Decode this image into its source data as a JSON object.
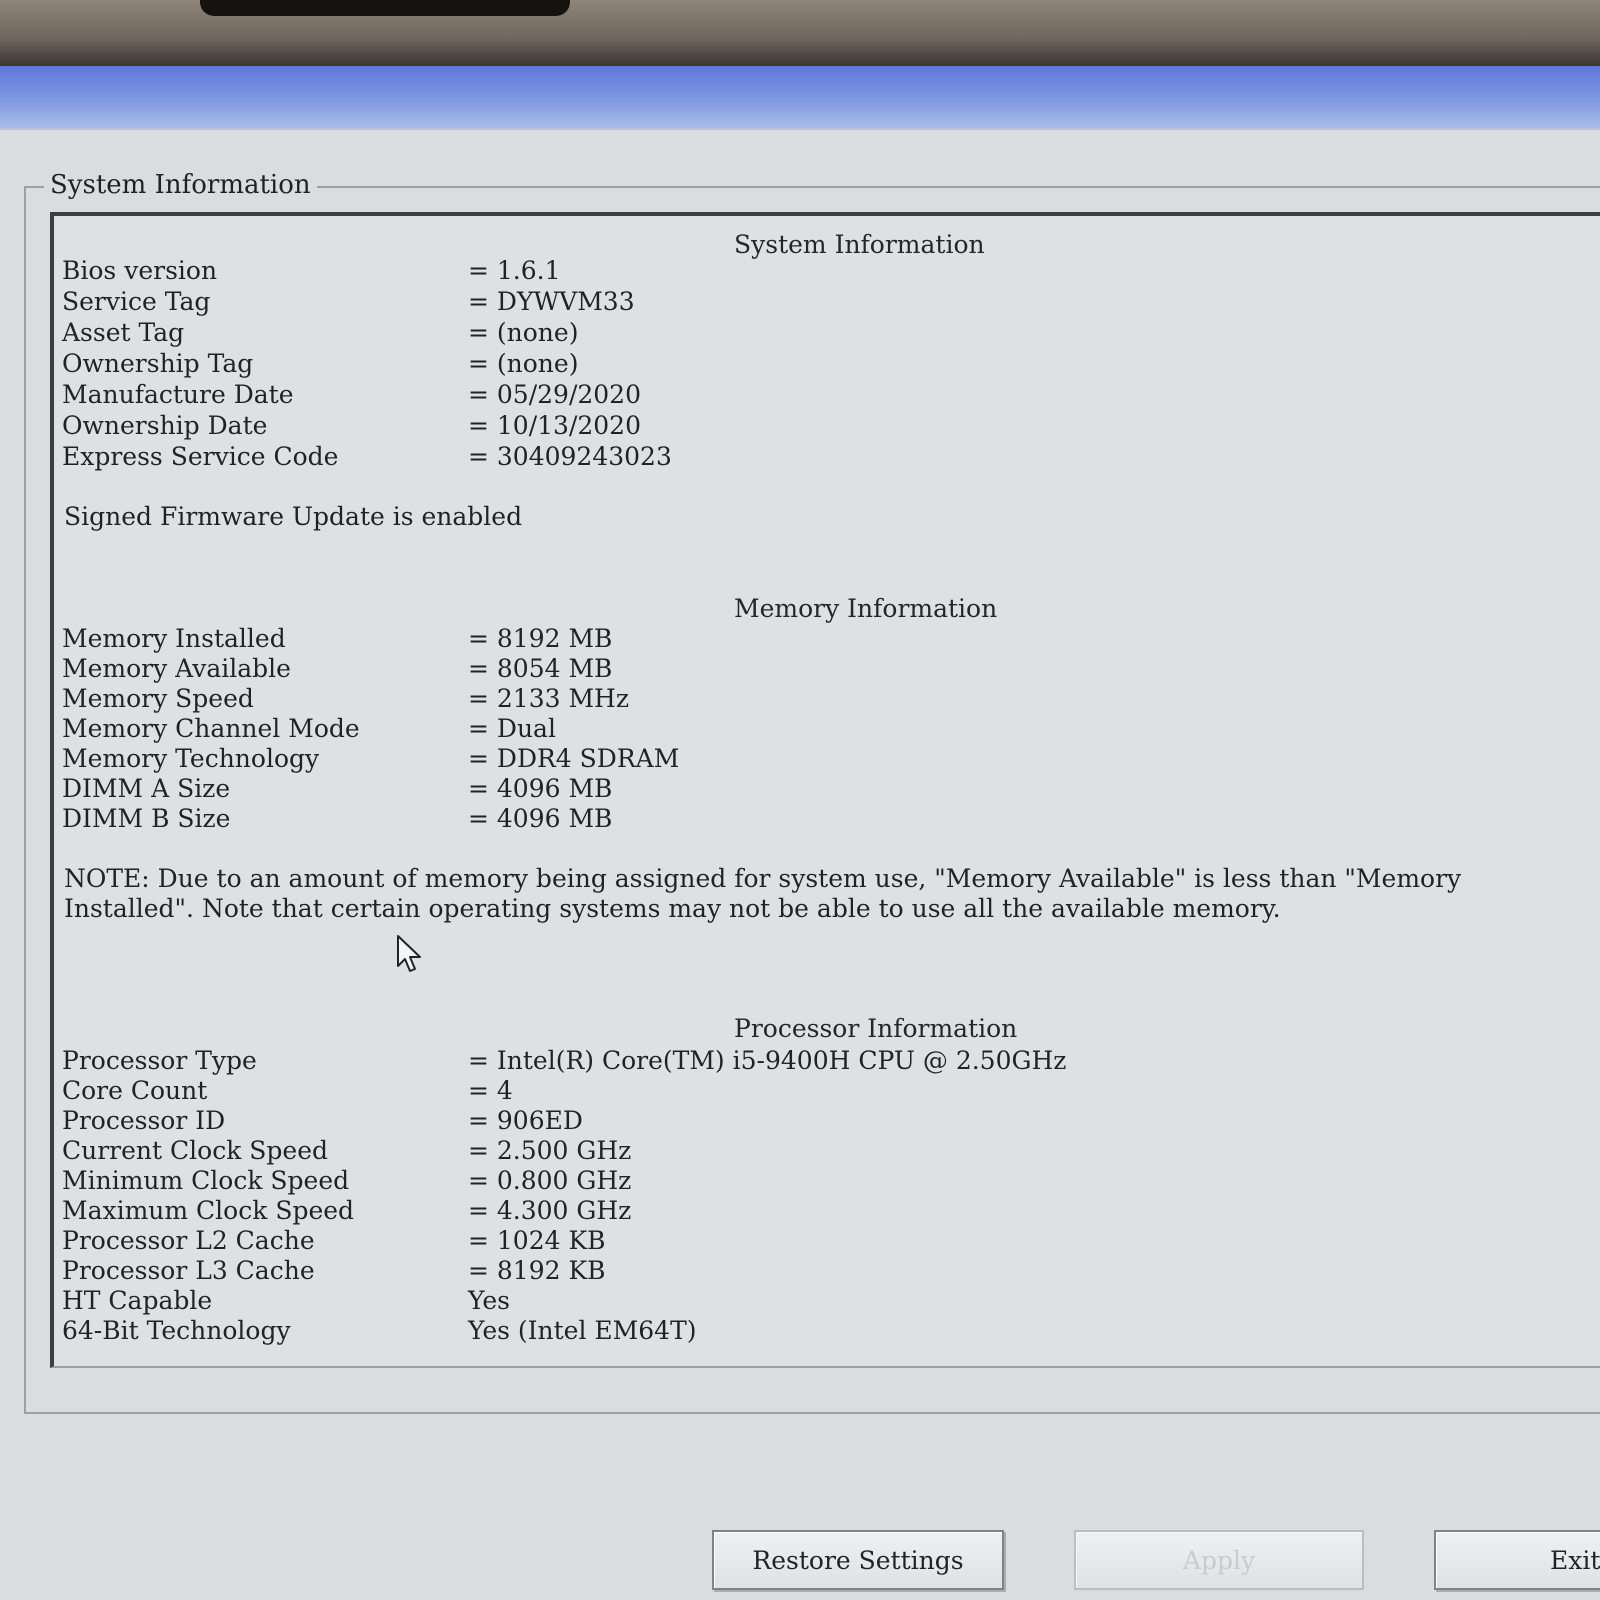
{
  "groupbox": {
    "title": "System Information"
  },
  "system": {
    "title": "System Information",
    "rows": [
      {
        "label": "Bios version",
        "value": "= 1.6.1"
      },
      {
        "label": "Service Tag",
        "value": "= DYWVM33"
      },
      {
        "label": "Asset Tag",
        "value": "= (none)"
      },
      {
        "label": "Ownership Tag",
        "value": "= (none)"
      },
      {
        "label": "Manufacture Date",
        "value": "= 05/29/2020"
      },
      {
        "label": "Ownership Date",
        "value": "= 10/13/2020"
      },
      {
        "label": "Express Service Code",
        "value": "= 30409243023"
      }
    ],
    "firmware_status": "Signed Firmware Update is enabled"
  },
  "memory": {
    "title": "Memory Information",
    "rows": [
      {
        "label": "Memory Installed",
        "value": "= 8192 MB"
      },
      {
        "label": "Memory Available",
        "value": "= 8054 MB"
      },
      {
        "label": "Memory Speed",
        "value": "= 2133 MHz"
      },
      {
        "label": "Memory Channel Mode",
        "value": "= Dual"
      },
      {
        "label": "Memory Technology",
        "value": "= DDR4 SDRAM"
      },
      {
        "label": "DIMM A Size",
        "value": "= 4096 MB"
      },
      {
        "label": "DIMM B Size",
        "value": "= 4096 MB"
      }
    ],
    "note": "NOTE: Due to an amount of memory being assigned for system use, \"Memory Available\" is less than \"Memory Installed\". Note that certain operating systems may not be able to use all the available memory."
  },
  "processor": {
    "title": "Processor Information",
    "rows": [
      {
        "label": "Processor Type",
        "value": "= Intel(R) Core(TM) i5-9400H CPU @ 2.50GHz"
      },
      {
        "label": "Core Count",
        "value": "= 4"
      },
      {
        "label": "Processor ID",
        "value": "= 906ED"
      },
      {
        "label": "Current Clock Speed",
        "value": "= 2.500 GHz"
      },
      {
        "label": "Minimum Clock Speed",
        "value": "= 0.800 GHz"
      },
      {
        "label": "Maximum Clock Speed",
        "value": "= 4.300 GHz"
      },
      {
        "label": "Processor L2 Cache",
        "value": "= 1024 KB"
      },
      {
        "label": "Processor L3 Cache",
        "value": "= 8192 KB"
      },
      {
        "label": "HT Capable",
        "value": "Yes"
      },
      {
        "label": "64-Bit Technology",
        "value": "Yes (Intel EM64T)"
      }
    ]
  },
  "buttons": {
    "restore": "Restore Settings",
    "apply": "Apply",
    "exit": "Exit"
  },
  "icons": {
    "cursor": "mouse-pointer-icon"
  },
  "colors": {
    "title_bar": "#6b86dc",
    "background": "#d9dde0"
  }
}
